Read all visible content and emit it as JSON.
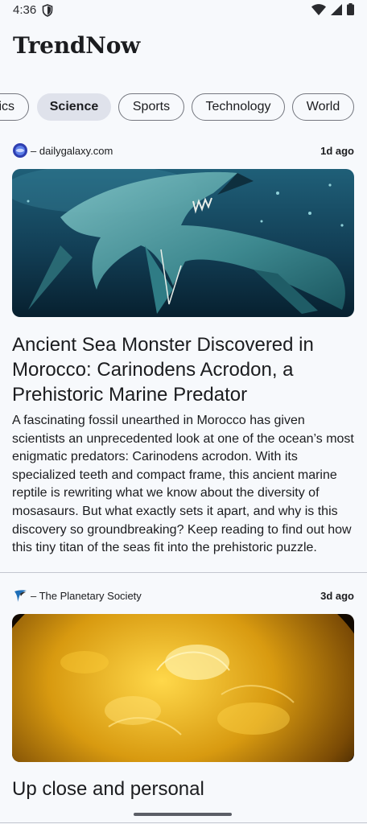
{
  "status": {
    "time": "4:36"
  },
  "app": {
    "title": "TrendNow"
  },
  "categories": [
    "ics",
    "Science",
    "Sports",
    "Technology",
    "World"
  ],
  "articles": [
    {
      "source": "– dailygalaxy.com",
      "time": "1d ago",
      "headline": "Ancient Sea Monster Discovered in Morocco: Carinodens Acrodon, a Prehistoric Marine Predator",
      "summary": "A fascinating fossil unearthed in Morocco has given scientists an unprecedented look at one of the ocean’s most enigmatic predators: Carinodens acrodon. With its specialized teeth and compact frame, this ancient marine reptile is rewriting what we know about the diversity of mosasaurs. But what exactly sets it apart, and why is this discovery so groundbreaking? Keep reading to find out how this tiny titan of the seas fit into the prehistoric puzzle."
    },
    {
      "source": "– The Planetary Society",
      "time": "3d ago",
      "headline": "Up close and personal"
    }
  ],
  "icons": [
    "shield-icon",
    "wifi-icon",
    "signal-icon",
    "battery-icon",
    "dailygalaxy-logo-icon",
    "planetary-society-logo-icon"
  ],
  "colors": {
    "selected_chip": "#dfe2eb",
    "chip_border": "#74777f",
    "background": "#f7f9fc"
  }
}
